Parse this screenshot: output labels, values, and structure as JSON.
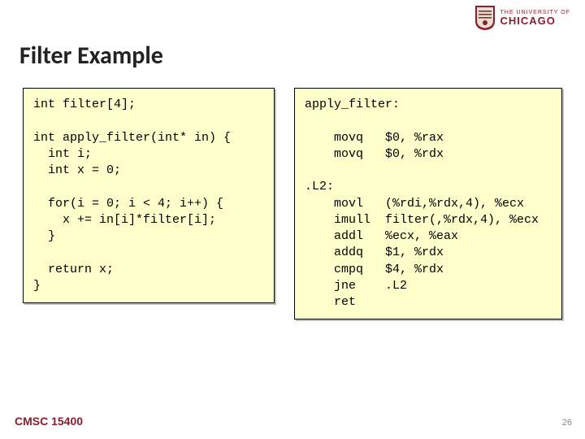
{
  "logo": {
    "line1": "THE UNIVERSITY OF",
    "line2": "CHICAGO"
  },
  "title": "Filter Example",
  "code_left": "int filter[4];\n\nint apply_filter(int* in) {\n  int i;\n  int x = 0;\n\n  for(i = 0; i < 4; i++) {\n    x += in[i]*filter[i];\n  }\n\n  return x;\n}",
  "code_right": "apply_filter:\n\n    movq   $0, %rax\n    movq   $0, %rdx\n\n.L2:\n    movl   (%rdi,%rdx,4), %ecx\n    imull  filter(,%rdx,4), %ecx\n    addl   %ecx, %eax\n    addq   $1, %rdx\n    cmpq   $4, %rdx\n    jne    .L2\n    ret",
  "footer": "CMSC 15400",
  "page_number": "26"
}
